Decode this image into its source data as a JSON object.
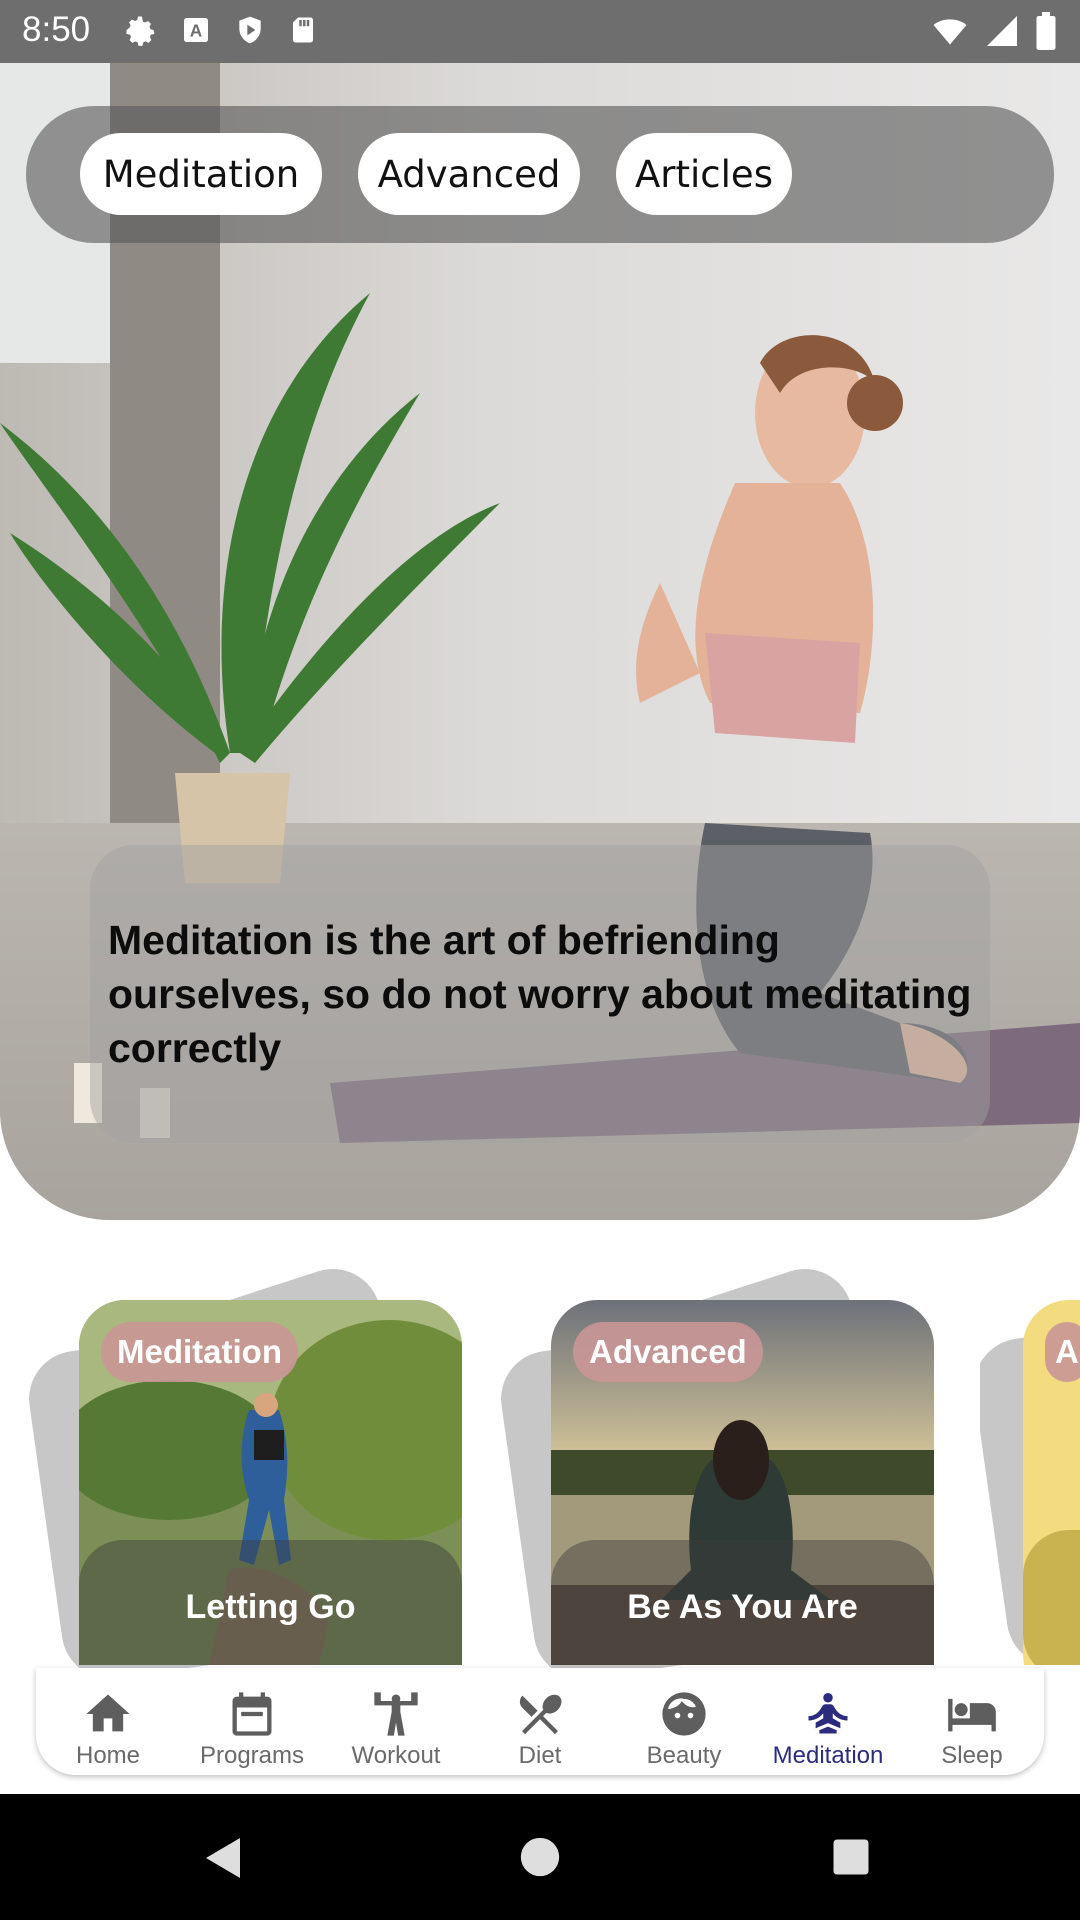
{
  "status_bar": {
    "time": "8:50",
    "left_icons": [
      "gear-icon",
      "keyboard-a-icon",
      "shield-play-icon",
      "sd-card-icon"
    ],
    "right_icons": [
      "wifi-icon",
      "signal-icon",
      "battery-icon"
    ]
  },
  "hero": {
    "chips": [
      "Meditation",
      "Advanced",
      "Articles"
    ],
    "quote": "Meditation is the art of befriending ourselves, so do not worry about meditating correctly"
  },
  "cards": [
    {
      "tag": "Meditation",
      "title": "Letting Go"
    },
    {
      "tag": "Advanced",
      "title": "Be As You Are"
    },
    {
      "tag": "A",
      "title": ""
    }
  ],
  "bottom_nav": {
    "items": [
      {
        "label": "Home",
        "icon": "home-icon"
      },
      {
        "label": "Programs",
        "icon": "calendar-icon"
      },
      {
        "label": "Workout",
        "icon": "weightlifter-icon"
      },
      {
        "label": "Diet",
        "icon": "fork-knife-icon"
      },
      {
        "label": "Beauty",
        "icon": "face-icon"
      },
      {
        "label": "Meditation",
        "icon": "meditation-icon"
      },
      {
        "label": "Sleep",
        "icon": "bed-icon"
      }
    ],
    "active": "Meditation"
  },
  "colors": {
    "status_bar": "#6e6e6e",
    "accent": "#2b2c7d",
    "tag": "#c99696",
    "nav_inactive": "#6a6a6a"
  }
}
